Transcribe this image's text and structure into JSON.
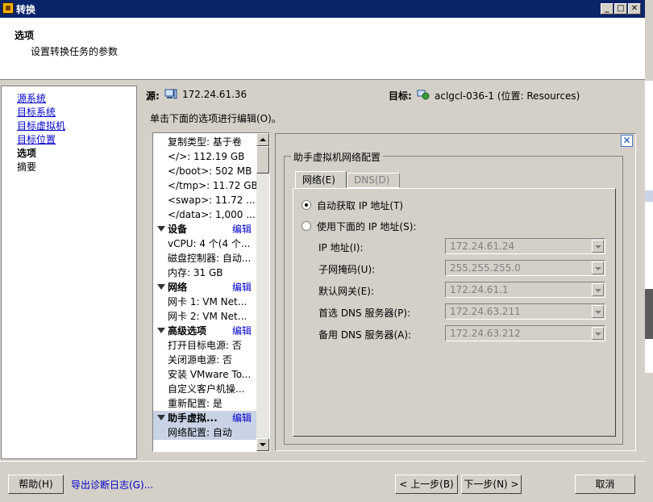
{
  "window": {
    "title": "转换",
    "controls": [
      "_",
      "□",
      "✕"
    ]
  },
  "header": {
    "title": "选项",
    "subtitle": "设置转换任务的参数"
  },
  "nav": {
    "items": [
      {
        "label": "源系统",
        "state": "link"
      },
      {
        "label": "目标系统",
        "state": "link"
      },
      {
        "label": "目标虚拟机",
        "state": "link"
      },
      {
        "label": "目标位置",
        "state": "link"
      },
      {
        "label": "选项",
        "state": "current"
      },
      {
        "label": "摘要",
        "state": "plain"
      }
    ]
  },
  "source": {
    "label": "源:",
    "value": "172.24.61.36"
  },
  "target": {
    "label": "目标:",
    "value": "aclgcl-036-1 (位置: Resources)"
  },
  "instruction": "单击下面的选项进行编辑(O)。",
  "tree": {
    "edit_label": "编辑",
    "rows": [
      {
        "text": "复制类型: 基于卷",
        "type": "item"
      },
      {
        "text": "</>: 112.19 GB",
        "type": "item"
      },
      {
        "text": "</boot>: 502 MB",
        "type": "item"
      },
      {
        "text": "</tmp>: 11.72 GB",
        "type": "item"
      },
      {
        "text": "<swap>: 11.72 ...",
        "type": "item"
      },
      {
        "text": "</data>: 1,000 ...",
        "type": "item"
      },
      {
        "text": "设备",
        "type": "section"
      },
      {
        "text": "vCPU: 4 个(4 个...",
        "type": "item"
      },
      {
        "text": "磁盘控制器: 自动...",
        "type": "item"
      },
      {
        "text": "内存: 31 GB",
        "type": "item"
      },
      {
        "text": "网络",
        "type": "section"
      },
      {
        "text": "网卡 1: VM Net...",
        "type": "item"
      },
      {
        "text": "网卡 2: VM Net...",
        "type": "item"
      },
      {
        "text": "高级选项",
        "type": "section"
      },
      {
        "text": "打开目标电源: 否",
        "type": "item"
      },
      {
        "text": "关闭源电源: 否",
        "type": "item"
      },
      {
        "text": "安装 VMware To...",
        "type": "item"
      },
      {
        "text": "自定义客户机操...",
        "type": "item"
      },
      {
        "text": "重新配置: 是",
        "type": "item"
      },
      {
        "text": "助手虚拟...",
        "type": "section",
        "selected": true
      },
      {
        "text": "网络配置: 自动",
        "type": "item",
        "selected": true
      }
    ]
  },
  "panel": {
    "group_title": "助手虚拟机网络配置",
    "tabs": [
      {
        "label": "网络(E)",
        "active": true
      },
      {
        "label": "DNS(D)",
        "active": false
      }
    ],
    "radio_auto": {
      "label": "自动获取 IP 地址(T)",
      "checked": true
    },
    "radio_manual": {
      "label": "使用下面的 IP 地址(S):",
      "checked": false
    },
    "fields": [
      {
        "label": "IP 地址(I):",
        "value": "172.24.61.24"
      },
      {
        "label": "子网掩码(U):",
        "value": "255.255.255.0"
      },
      {
        "label": "默认网关(E):",
        "value": "172.24.61.1"
      },
      {
        "label": "首选 DNS 服务器(P):",
        "value": "172.24.63.211"
      },
      {
        "label": "备用 DNS 服务器(A):",
        "value": "172.24.63.212"
      }
    ]
  },
  "footer": {
    "help": "帮助(H)",
    "export_logs": "导出诊断日志(G)...",
    "back": "< 上一步(B)",
    "next": "下一步(N) >",
    "cancel": "取消"
  },
  "colors": {
    "titlebar": "#0a246a",
    "link": "#0000cc",
    "selection": "#c9d3e6"
  }
}
